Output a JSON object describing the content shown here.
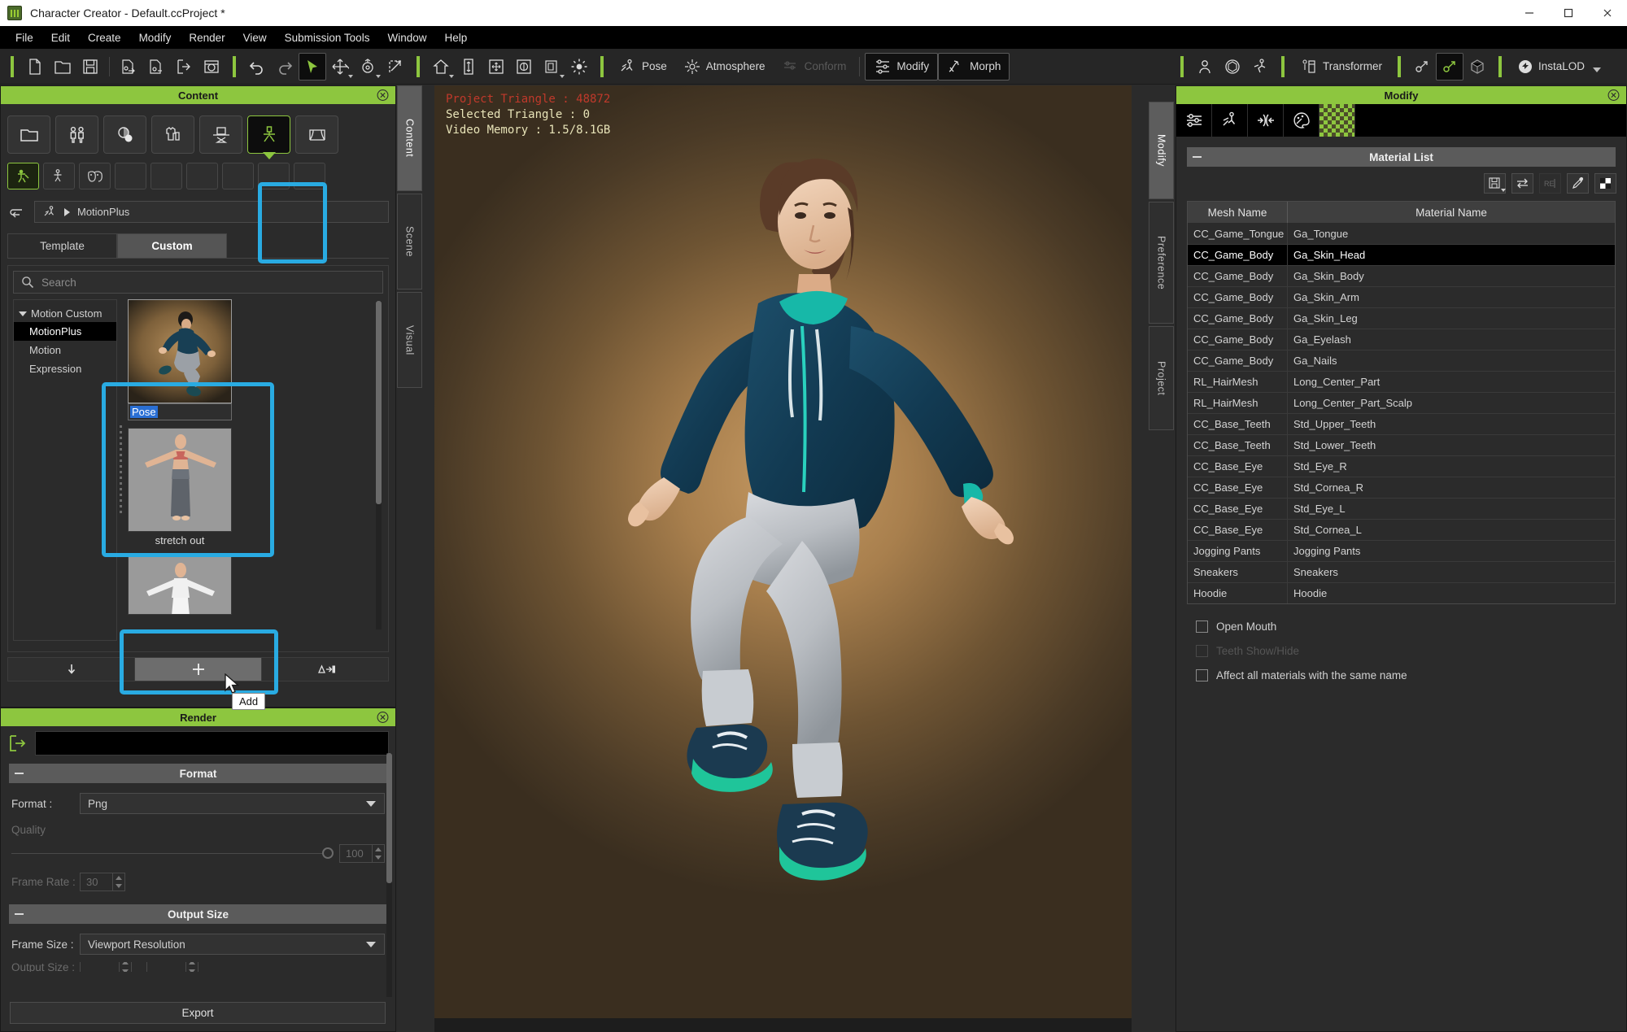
{
  "window": {
    "title": "Character Creator - Default.ccProject *",
    "icon": "app-icon",
    "minimize": "—",
    "maximize": "☐",
    "close": "✕"
  },
  "menubar": {
    "items": [
      "File",
      "Edit",
      "Create",
      "Modify",
      "Render",
      "View",
      "Submission Tools",
      "Window",
      "Help"
    ]
  },
  "toolbar": {
    "groups": [
      {
        "icons": [
          "new-project-icon",
          "open-project-icon",
          "save-project-icon"
        ]
      },
      {
        "icons": [
          "import-character-icon",
          "export-character-icon",
          "export-icon",
          "save-image-icon"
        ]
      },
      {
        "icons": [
          "undo-icon",
          "redo-icon"
        ]
      },
      {
        "icons": [
          "select-tool-icon",
          "move-tool-icon",
          "rotate-tool-icon",
          "scale-tool-icon"
        ]
      },
      {
        "icons": [
          "home-view-icon",
          "fit-height-icon",
          "fit-all-icon",
          "frame-icon",
          "isolate-icon",
          "light-icon"
        ]
      }
    ],
    "labeled": [
      {
        "label": "Pose",
        "icon": "pose-icon",
        "state": "normal"
      },
      {
        "label": "Atmosphere",
        "icon": "atmosphere-icon",
        "state": "normal"
      },
      {
        "label": "Conform",
        "icon": "conform-icon",
        "state": "disabled"
      },
      {
        "label": "Modify",
        "icon": "modify-icon",
        "state": "active"
      },
      {
        "label": "Morph",
        "icon": "morph-icon",
        "state": "active"
      }
    ],
    "right_icons": [
      "avatar-icon",
      "sphere-icon",
      "motion-icon"
    ],
    "transformer_label": "Transformer",
    "transformer_icon": "transformer-icon",
    "edit_icons": [
      "edit-mesh-icon",
      "edit-bone-icon",
      "edit-lod-icon"
    ],
    "instalod_label": "InstaLOD",
    "instalod_icon": "instalod-icon"
  },
  "left_dock": {
    "vertical_tabs": [
      {
        "label": "Content",
        "active": true
      },
      {
        "label": "Scene",
        "active": false
      },
      {
        "label": "Visual",
        "active": false
      }
    ]
  },
  "content_panel": {
    "title": "Content",
    "close_icon": "close-icon",
    "categories": [
      {
        "name": "folder-icon",
        "selected": false
      },
      {
        "name": "character-icon",
        "selected": false
      },
      {
        "name": "material-icon",
        "selected": false
      },
      {
        "name": "cloth-icon",
        "selected": false
      },
      {
        "name": "accessory-icon",
        "selected": false
      },
      {
        "name": "motion-pose-icon",
        "selected": true
      },
      {
        "name": "stage-icon",
        "selected": false
      }
    ],
    "subcategories": [
      {
        "name": "motionplus-icon",
        "selected": true
      },
      {
        "name": "motion-icon",
        "selected": false
      },
      {
        "name": "expression-icon",
        "selected": false
      },
      {
        "name": "empty-slot-icon",
        "selected": false
      },
      {
        "name": "empty-slot-icon",
        "selected": false
      },
      {
        "name": "empty-slot-icon",
        "selected": false
      },
      {
        "name": "empty-slot-icon",
        "selected": false
      },
      {
        "name": "empty-slot-icon",
        "selected": false
      },
      {
        "name": "empty-slot-icon",
        "selected": false
      }
    ],
    "back_icon": "back-arrow-icon",
    "breadcrumb": {
      "icon": "running-figure-icon",
      "arrow": "▶",
      "label": "MotionPlus"
    },
    "tabs": [
      {
        "label": "Template",
        "active": false
      },
      {
        "label": "Custom",
        "active": true
      }
    ],
    "search": {
      "placeholder": "Search",
      "value": "",
      "icon": "search-icon"
    },
    "tree": {
      "root": {
        "label": "Motion Custom",
        "expanded": true
      },
      "items": [
        {
          "label": "MotionPlus",
          "selected": true
        },
        {
          "label": "Motion",
          "selected": false
        },
        {
          "label": "Expression",
          "selected": false
        }
      ]
    },
    "thumbnails": [
      {
        "label": "Pose",
        "editing": true,
        "selected": true
      },
      {
        "label": "stretch out",
        "editing": false,
        "selected": false
      },
      {
        "label": "",
        "editing": false,
        "selected": false
      }
    ],
    "bottom_buttons": [
      {
        "name": "apply-icon",
        "glyph": "↓",
        "highlighted": false
      },
      {
        "name": "add-button",
        "glyph": "+",
        "highlighted": true
      },
      {
        "name": "convert-icon",
        "glyph": "Δ→█",
        "highlighted": false
      }
    ],
    "tooltip": "Add"
  },
  "render_panel": {
    "title": "Render",
    "close_icon": "close-icon",
    "export_path_icon": "export-path-icon",
    "export_path_value": "",
    "sections": [
      {
        "label": "Format"
      },
      {
        "label": "Output Size"
      }
    ],
    "format_label": "Format :",
    "format_value": "Png",
    "quality_label": "Quality",
    "quality_value": "100",
    "frame_rate_label": "Frame Rate :",
    "frame_rate_value": "30",
    "frame_size_label": "Frame Size :",
    "frame_size_value": "Viewport Resolution",
    "output_size_label": "Output Size :",
    "export_button": "Export"
  },
  "viewport": {
    "stats": {
      "project_triangle": "Project Triangle : 48872",
      "selected_triangle": "Selected Triangle : 0",
      "video_memory": "Video Memory : 1.5/8.1GB"
    },
    "stat_colors": {
      "project": "#c0392b",
      "other": "#e8e4b8"
    }
  },
  "right_dock": {
    "vertical_tabs": [
      {
        "label": "Modify",
        "active": true
      },
      {
        "label": "Preference",
        "active": false
      },
      {
        "label": "Project",
        "active": false
      }
    ]
  },
  "modify_panel": {
    "title": "Modify",
    "close_icon": "close-icon",
    "tabs": [
      {
        "name": "attribute-icon",
        "active": false
      },
      {
        "name": "pose-icon",
        "active": false
      },
      {
        "name": "collision-icon",
        "active": false
      },
      {
        "name": "palette-icon",
        "active": false
      },
      {
        "name": "material-checker-icon",
        "active": true
      }
    ],
    "section_label": "Material List",
    "toolbar_icons": [
      {
        "name": "save-material-icon",
        "disabled": false,
        "caret": true
      },
      {
        "name": "swap-material-icon",
        "disabled": false,
        "caret": false
      },
      {
        "name": "reset-material-icon",
        "disabled": true,
        "caret": false
      },
      {
        "name": "eyedropper-icon",
        "disabled": false,
        "caret": false
      },
      {
        "name": "two-tone-icon",
        "disabled": false,
        "caret": false
      }
    ],
    "table": {
      "headers": [
        "Mesh Name",
        "Material Name"
      ],
      "rows": [
        {
          "mesh": "CC_Game_Tongue",
          "material": "Ga_Tongue",
          "selected": false
        },
        {
          "mesh": "CC_Game_Body",
          "material": "Ga_Skin_Head",
          "selected": true
        },
        {
          "mesh": "CC_Game_Body",
          "material": "Ga_Skin_Body",
          "selected": false
        },
        {
          "mesh": "CC_Game_Body",
          "material": "Ga_Skin_Arm",
          "selected": false
        },
        {
          "mesh": "CC_Game_Body",
          "material": "Ga_Skin_Leg",
          "selected": false
        },
        {
          "mesh": "CC_Game_Body",
          "material": "Ga_Eyelash",
          "selected": false
        },
        {
          "mesh": "CC_Game_Body",
          "material": "Ga_Nails",
          "selected": false
        },
        {
          "mesh": "RL_HairMesh",
          "material": "Long_Center_Part",
          "selected": false
        },
        {
          "mesh": "RL_HairMesh",
          "material": "Long_Center_Part_Scalp",
          "selected": false
        },
        {
          "mesh": "CC_Base_Teeth",
          "material": "Std_Upper_Teeth",
          "selected": false
        },
        {
          "mesh": "CC_Base_Teeth",
          "material": "Std_Lower_Teeth",
          "selected": false
        },
        {
          "mesh": "CC_Base_Eye",
          "material": "Std_Eye_R",
          "selected": false
        },
        {
          "mesh": "CC_Base_Eye",
          "material": "Std_Cornea_R",
          "selected": false
        },
        {
          "mesh": "CC_Base_Eye",
          "material": "Std_Eye_L",
          "selected": false
        },
        {
          "mesh": "CC_Base_Eye",
          "material": "Std_Cornea_L",
          "selected": false
        },
        {
          "mesh": "Jogging Pants",
          "material": "Jogging Pants",
          "selected": false
        },
        {
          "mesh": "Sneakers",
          "material": "Sneakers",
          "selected": false
        },
        {
          "mesh": "Hoodie",
          "material": "Hoodie",
          "selected": false
        }
      ]
    },
    "checkboxes": [
      {
        "label": "Open Mouth",
        "checked": false,
        "disabled": false
      },
      {
        "label": "Teeth Show/Hide",
        "checked": false,
        "disabled": true
      },
      {
        "label": "Affect all materials with the same name",
        "checked": false,
        "disabled": false
      }
    ]
  },
  "colors": {
    "accent_green": "#8dc63f",
    "highlight_blue": "#29ABE2",
    "panel_bg": "#2b2b2b",
    "selection_black": "#000000",
    "text_select_blue": "#2a6fd4"
  }
}
